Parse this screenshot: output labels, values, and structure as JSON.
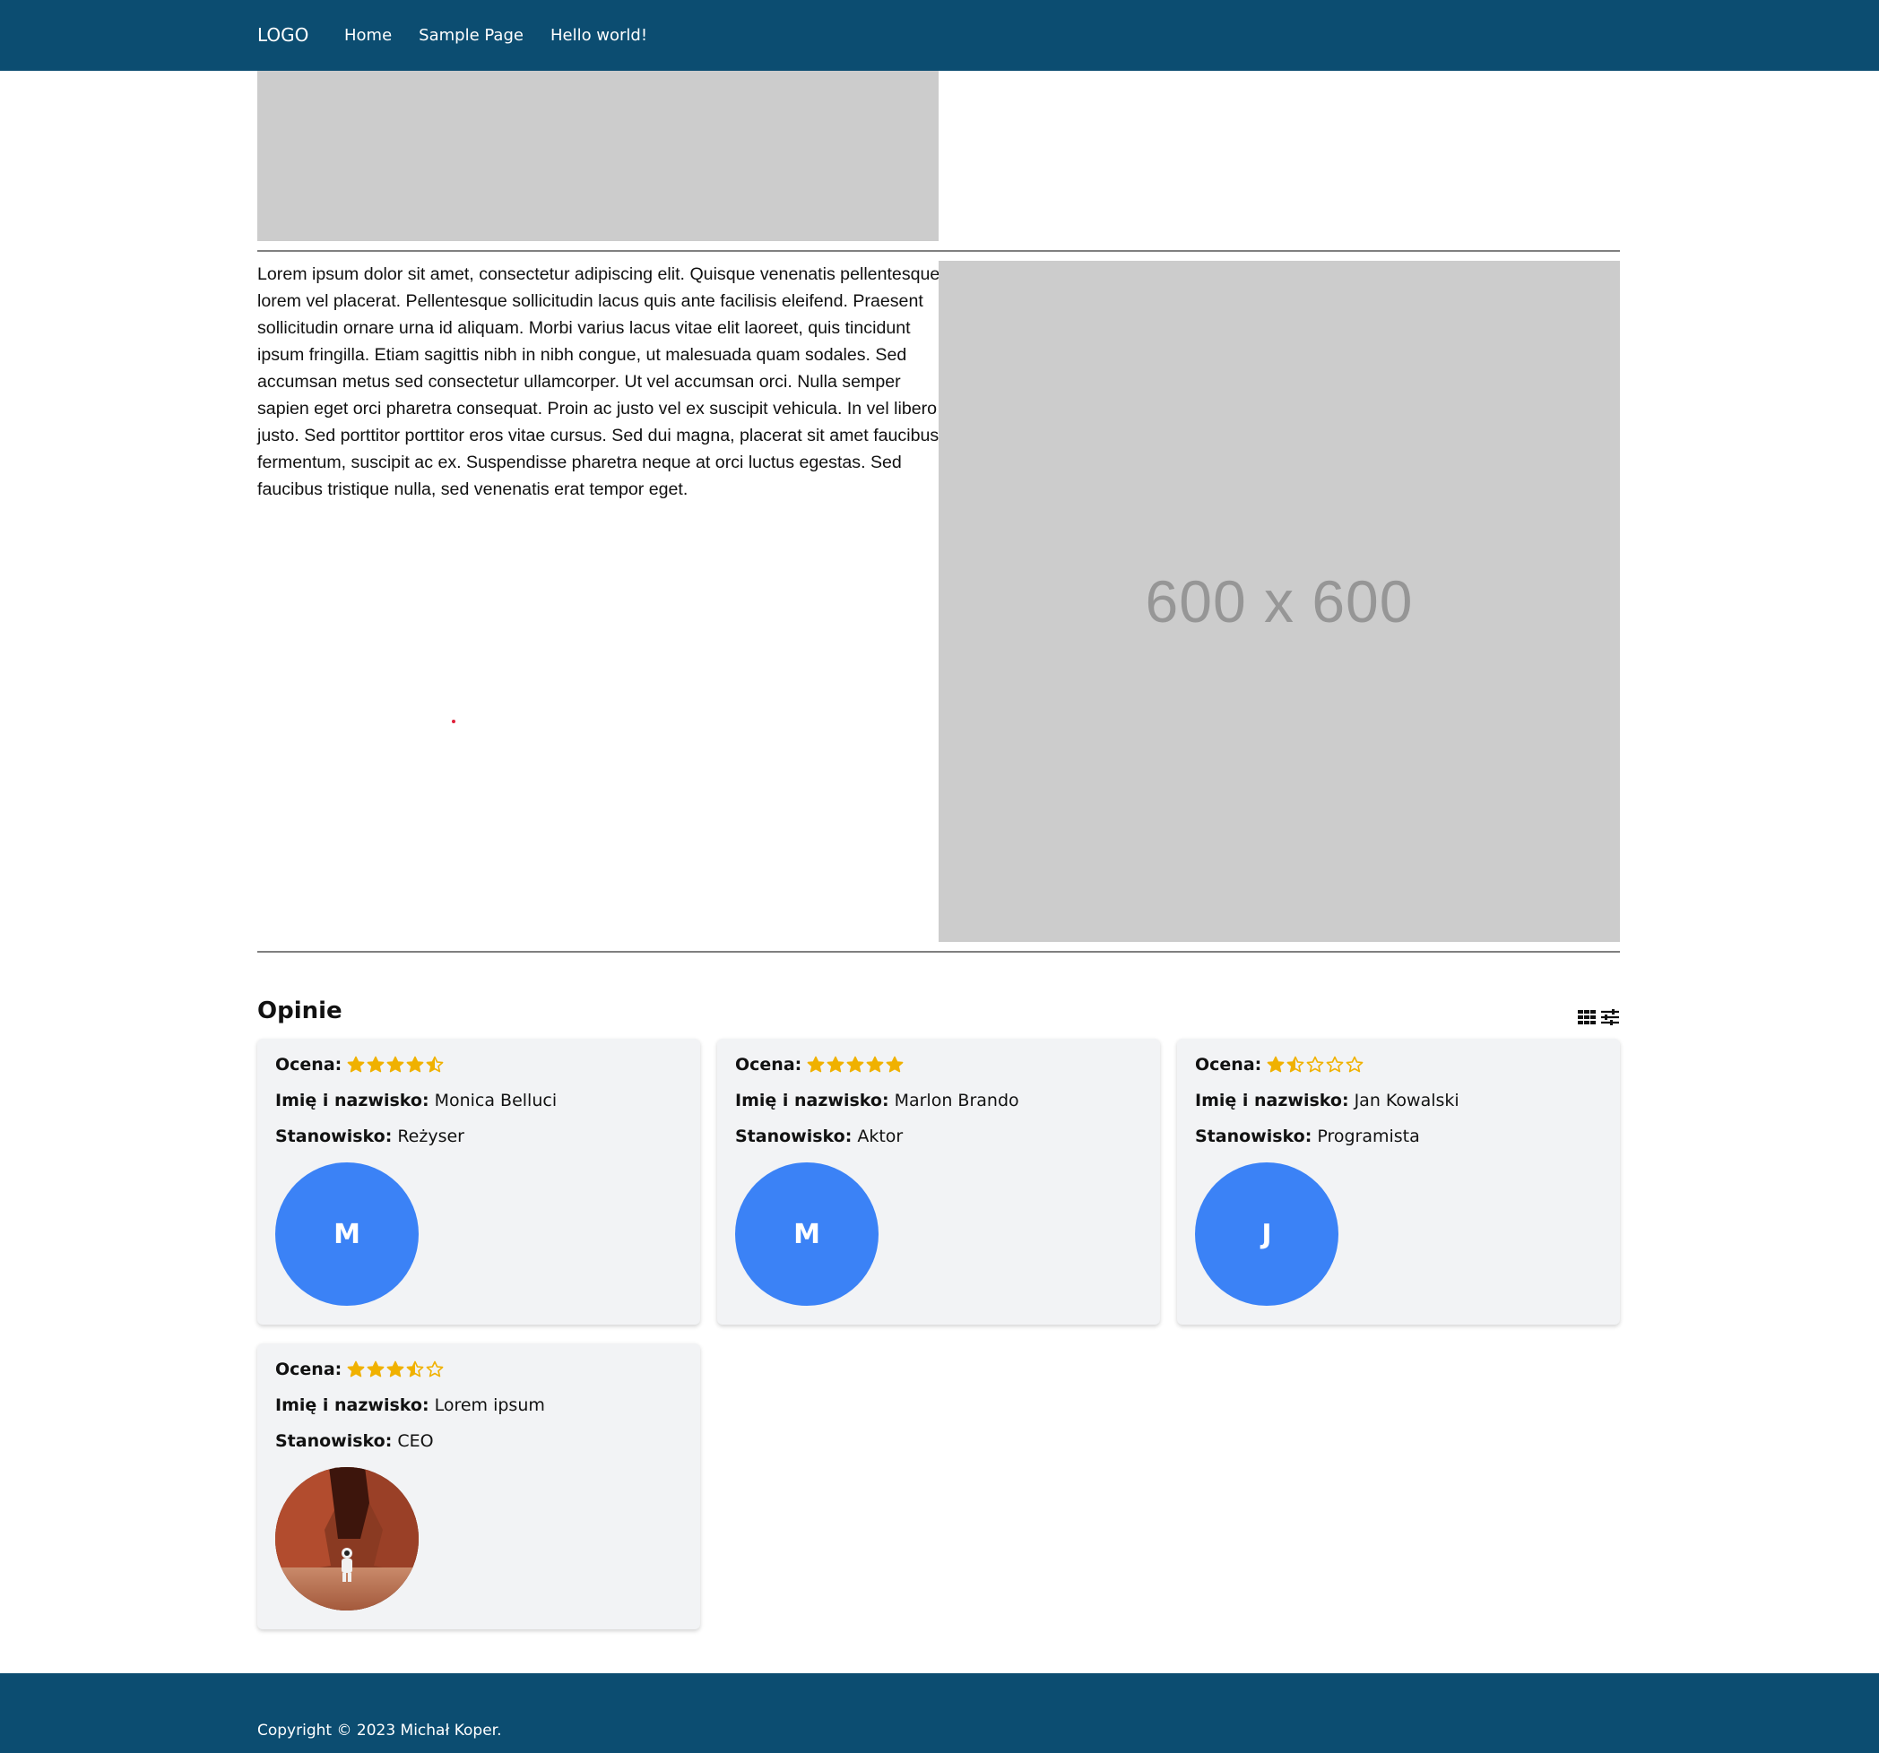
{
  "header": {
    "logo": "LOGO",
    "nav": [
      "Home",
      "Sample Page",
      "Hello world!"
    ]
  },
  "content": {
    "paragraph": "Lorem ipsum dolor sit amet, consectetur adipiscing elit. Quisque venenatis pellentesque lorem vel placerat. Pellentesque sollicitudin lacus quis ante facilisis eleifend. Praesent sollicitudin ornare urna id aliquam. Morbi varius lacus vitae elit laoreet, quis tincidunt ipsum fringilla. Etiam sagittis nibh in nibh congue, ut malesuada quam sodales. Sed accumsan metus sed consectetur ullamcorper. Ut vel accumsan orci. Nulla semper sapien eget orci pharetra consequat. Proin ac justo vel ex suscipit vehicula. In vel libero justo. Sed porttitor porttitor eros vitae cursus. Sed dui magna, placerat sit amet faucibus fermentum, suscipit ac ex. Suspendisse pharetra neque at orci luctus egestas. Sed faucibus tristique nulla, sed venenatis erat tempor eget.",
    "image_placeholder_text": "600 x 600"
  },
  "reviews": {
    "title": "Opinie",
    "labels": {
      "rating": "Ocena:",
      "name": "Imię i nazwisko:",
      "position": "Stanowisko:"
    },
    "items": [
      {
        "rating": 4.5,
        "name": "Monica Belluci",
        "position": "Reżyser",
        "avatar_letter": "M"
      },
      {
        "rating": 5,
        "name": "Marlon Brando",
        "position": "Aktor",
        "avatar_letter": "M"
      },
      {
        "rating": 1.5,
        "name": "Jan Kowalski",
        "position": "Programista",
        "avatar_letter": "J"
      },
      {
        "rating": 3.5,
        "name": "Lorem ipsum",
        "position": "CEO",
        "avatar_letter": ""
      }
    ]
  },
  "footer": {
    "copyright": "Copyright © 2023 Michał Koper."
  },
  "colors": {
    "header_bg": "#0c4d71",
    "star": "#f0b100",
    "avatar": "#3b82f6",
    "card_bg": "#f2f3f5",
    "placeholder": "#cccccc"
  },
  "icons": [
    "grid-view-icon",
    "list-view-icon",
    "star-icon"
  ]
}
